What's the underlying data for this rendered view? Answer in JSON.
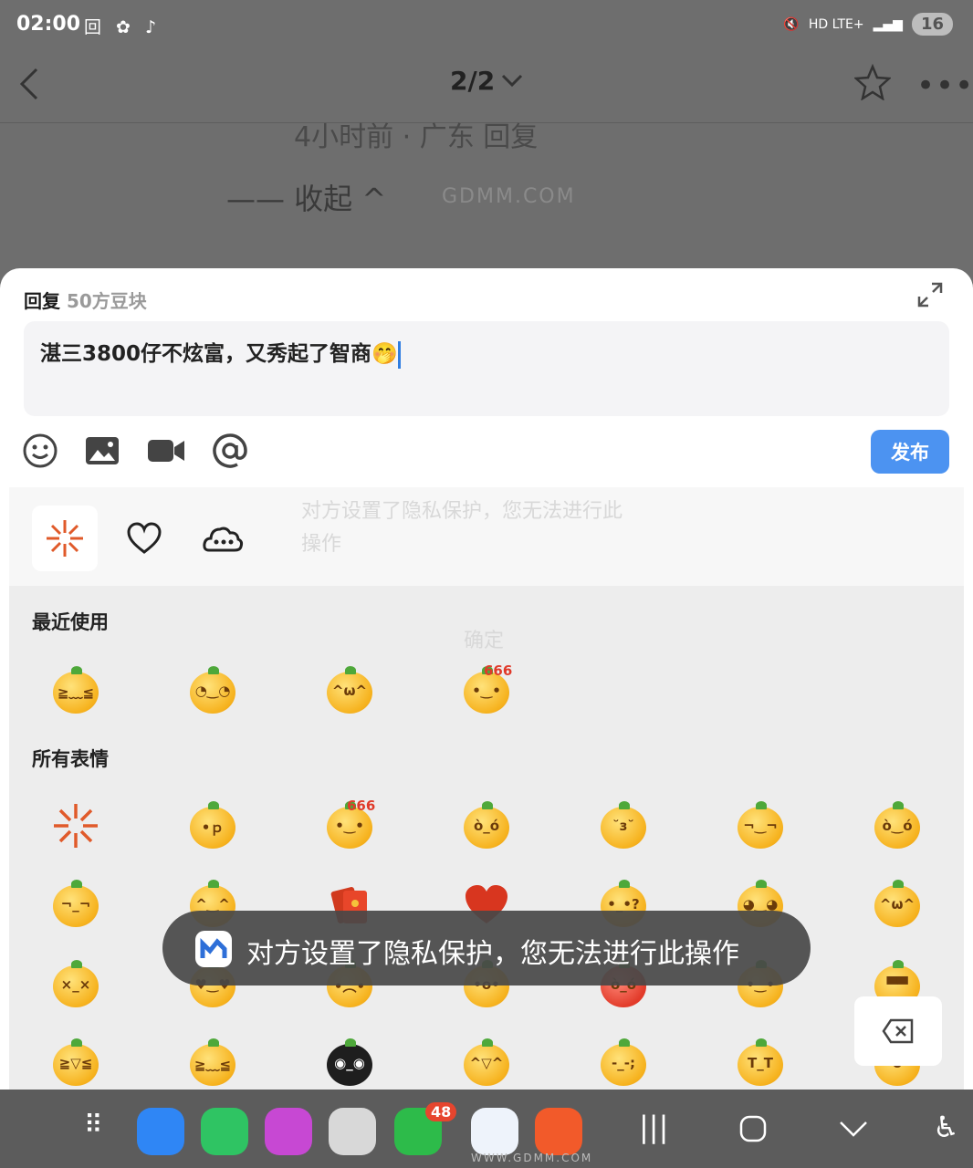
{
  "status": {
    "time": "02:00",
    "apps": "回 ✿ ♪",
    "network": "HD LTE+",
    "battery": "16"
  },
  "appbar": {
    "page": "2/2"
  },
  "background": {
    "meta": "4小时前 · 广东   回复",
    "collapse": "—— 收起 ^",
    "watermark": "GDMM.COM"
  },
  "reply": {
    "label": "回复",
    "target": "50方豆块",
    "text": "湛三3800仔不炫富，又秀起了智商🤭",
    "publish": "发布"
  },
  "dialog_ghost": {
    "msg_line1": "对方设置了隐私保护，您无法进行此",
    "msg_line2": "操作",
    "confirm": "确定"
  },
  "emoji": {
    "recent_title": "最近使用",
    "all_title": "所有表情",
    "recent": [
      "cry",
      "smug",
      "shy",
      "666"
    ],
    "all": [
      [
        "burst",
        "tongue",
        "666",
        "angry",
        "kiss",
        "smirk",
        "hug"
      ],
      [
        "meh",
        "smile",
        "redpacket",
        "heart",
        "question",
        "grin",
        "shy"
      ],
      [
        "sick",
        "love",
        "sad",
        "follow",
        "red",
        "peek",
        "cool"
      ],
      [
        "laugh",
        "cry",
        "dark",
        "happy",
        "sweat",
        "tears",
        "wow"
      ]
    ]
  },
  "toast": {
    "text": "对方设置了隐私保护，您无法进行此操作"
  },
  "dock": {
    "badge": "48",
    "watermark": "WWW.GDMM.COM"
  }
}
